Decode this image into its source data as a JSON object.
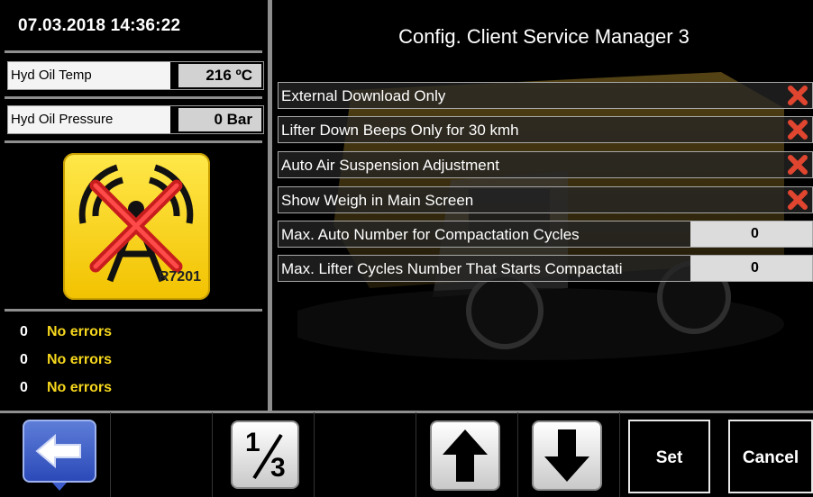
{
  "left_panel": {
    "datetime": "07.03.2018 14:36:22",
    "sensors": [
      {
        "label": "Hyd Oil Temp",
        "value": "216 ºC"
      },
      {
        "label": "Hyd Oil Pressure",
        "value": "0 Bar"
      }
    ],
    "status_icon": {
      "name": "no-signal-antenna-icon",
      "code": "R7201"
    },
    "errors": [
      {
        "count": "0",
        "text": "No errors"
      },
      {
        "count": "0",
        "text": "No errors"
      },
      {
        "count": "0",
        "text": "No errors"
      }
    ]
  },
  "main": {
    "title": "Config. Client Service Manager 3",
    "settings": [
      {
        "label": "External Download Only",
        "type": "toggle",
        "state": "off"
      },
      {
        "label": "Lifter Down Beeps Only for 30 kmh",
        "type": "toggle",
        "state": "off"
      },
      {
        "label": "Auto Air Suspension Adjustment",
        "type": "toggle",
        "state": "off"
      },
      {
        "label": "Show Weigh in Main Screen",
        "type": "toggle",
        "state": "off"
      },
      {
        "label": "Max. Auto Number for Compactation Cycles",
        "type": "number",
        "value": "0"
      },
      {
        "label": "Max. Lifter Cycles Number That Starts Compactati",
        "type": "number",
        "value": "0"
      }
    ]
  },
  "toolbar": {
    "page_numerator": "1",
    "page_denominator": "3",
    "set_label": "Set",
    "cancel_label": "Cancel"
  },
  "colors": {
    "error_text": "#f6d71d",
    "toggle_off": "#e0452f",
    "icon_yellow": "#ffd21f",
    "back_button": "#3d5ccc"
  }
}
